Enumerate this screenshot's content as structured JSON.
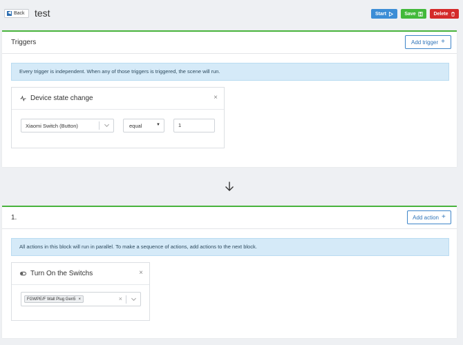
{
  "header": {
    "back_label": "Back",
    "title": "test",
    "start_label": "Start",
    "save_label": "Save",
    "delete_label": "Delete"
  },
  "triggers": {
    "title": "Triggers",
    "add_label": "Add trigger",
    "info": "Every trigger is independent. When any of those triggers is triggered, the scene will run.",
    "card": {
      "title": "Device state change",
      "device": "Xiaomi Switch (Button)",
      "operator": "equal",
      "value": "1"
    }
  },
  "actions": {
    "title": "1.",
    "add_label": "Add action",
    "info": "All actions in this block will run in parallel. To make a sequence of actions, add actions to the next block.",
    "card": {
      "title": "Turn On the Switchs",
      "selected": [
        "FGWPE/F Wall Plug Gen5"
      ]
    }
  },
  "colors": {
    "accent_green": "#48b43c",
    "start": "#3c8dd6",
    "save": "#42b93a",
    "delete": "#d42a2a",
    "link_blue": "#2f74b8",
    "info_bg": "#d5eaf8"
  },
  "icons": {
    "back": "chevron-left-icon",
    "start": "play-icon",
    "save": "save-icon",
    "delete": "trash-icon",
    "trigger_card": "activity-icon",
    "action_card": "toggle-icon",
    "separator": "arrow-down-icon"
  }
}
